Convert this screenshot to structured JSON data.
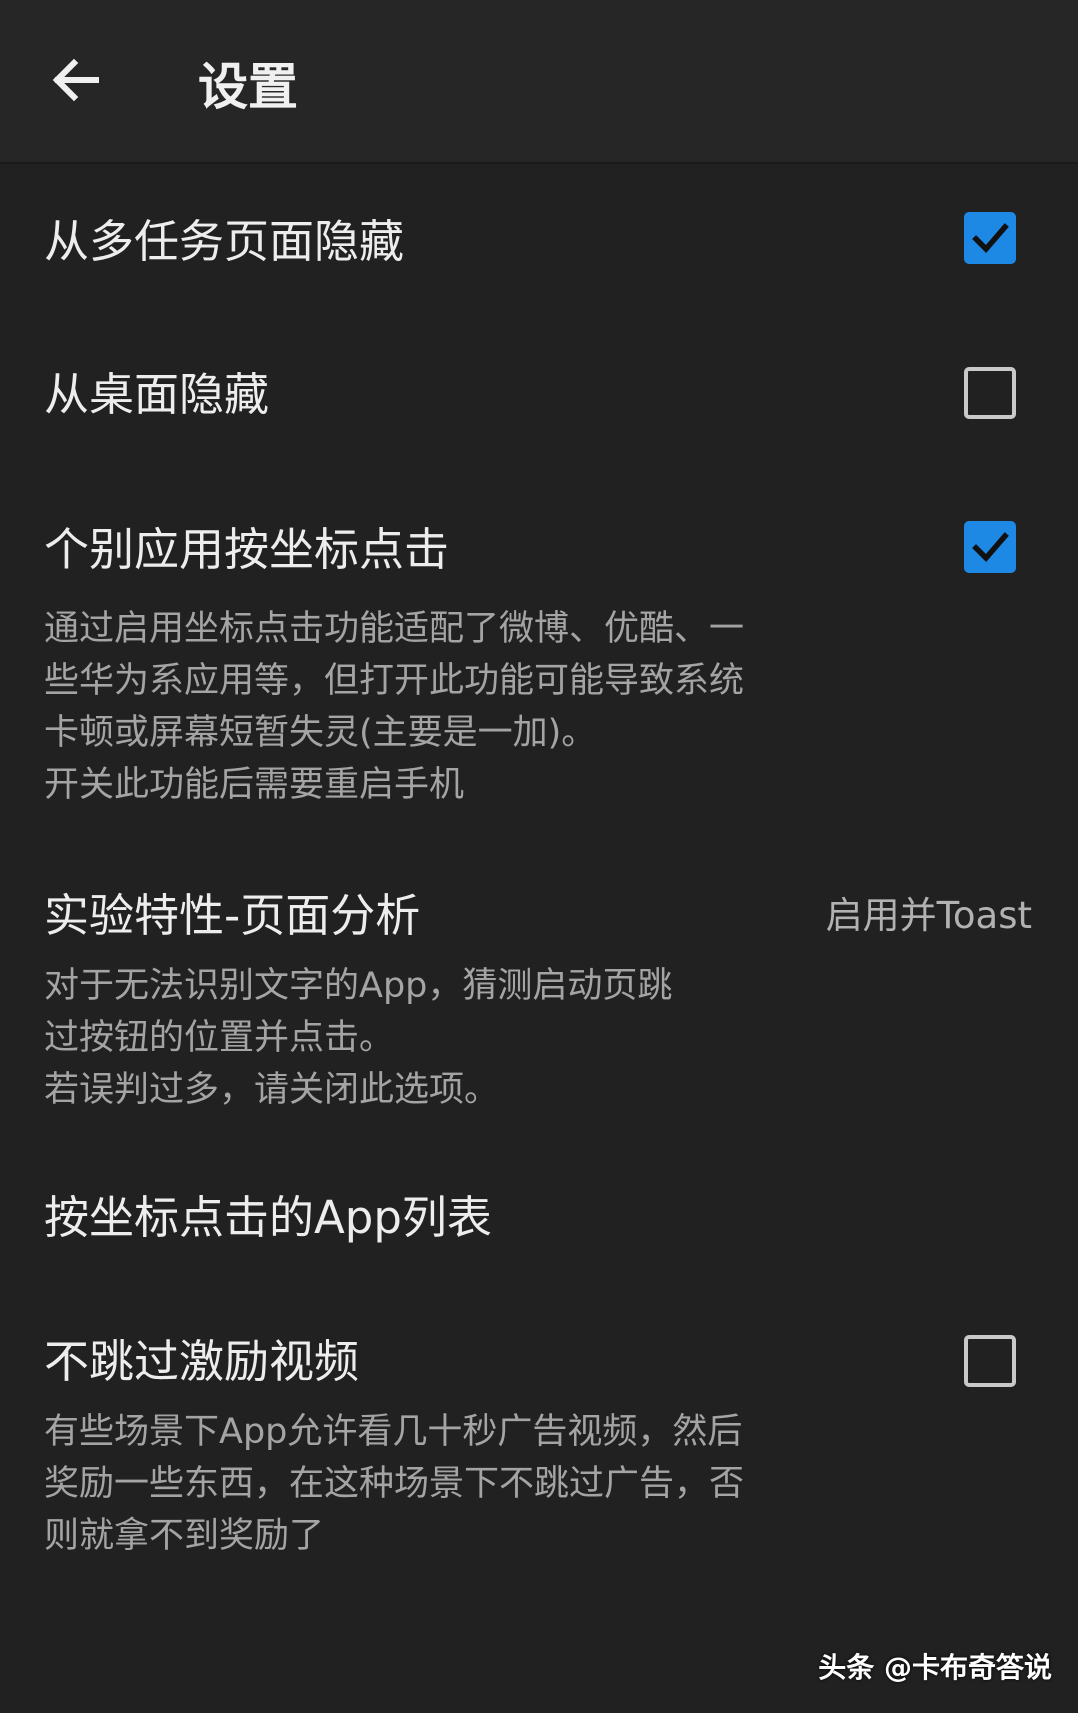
{
  "header": {
    "title": "设置",
    "back_icon": "arrow-left-icon"
  },
  "prefs": [
    {
      "title": "从多任务页面隐藏",
      "checked": true
    },
    {
      "title": "从桌面隐藏",
      "checked": false
    },
    {
      "title": "个别应用按坐标点击",
      "checked": true,
      "summary": [
        "通过启用坐标点击功能适配了微博、优酷、一",
        "些华为系应用等，但打开此功能可能导致系统",
        "卡顿或屏幕短暂失灵(主要是一加)。",
        "开关此功能后需要重启手机"
      ]
    },
    {
      "title": "实验特性-页面分析",
      "value": "启用并Toast",
      "summary": [
        "对于无法识别文字的App，猜测启动页跳",
        "过按钮的位置并点击。",
        "若误判过多，请关闭此选项。"
      ]
    },
    {
      "title": "按坐标点击的App列表"
    },
    {
      "title": "不跳过激励视频",
      "checked": false,
      "summary": [
        "有些场景下App允许看几十秒广告视频，然后",
        "奖励一些东西，在这种场景下不跳过广告，否",
        "则就拿不到奖励了"
      ]
    }
  ],
  "watermark": "头条 @卡布奇答说",
  "colors": {
    "background": "#212121",
    "appbar": "#262626",
    "accent": "#1e88e5",
    "title_text": "#ededed",
    "summary_text": "#a4a4a4"
  }
}
